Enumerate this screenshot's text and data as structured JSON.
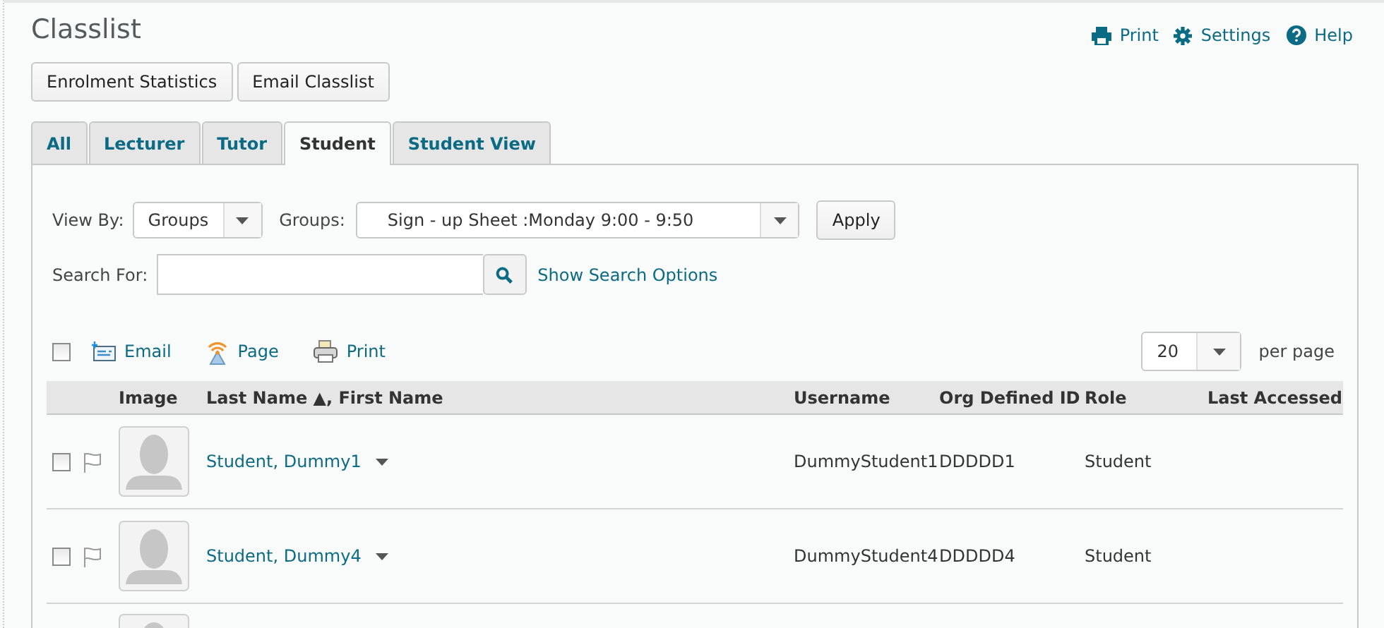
{
  "page": {
    "title": "Classlist"
  },
  "top_links": [
    {
      "kind": "print",
      "label": "Print"
    },
    {
      "kind": "settings",
      "label": "Settings"
    },
    {
      "kind": "help",
      "label": "Help"
    }
  ],
  "buttons": [
    "Enrolment Statistics",
    "Email Classlist"
  ],
  "tabs": [
    {
      "label": "All",
      "selected": false
    },
    {
      "label": "Lecturer",
      "selected": false
    },
    {
      "label": "Tutor",
      "selected": false
    },
    {
      "label": "Student",
      "selected": true
    },
    {
      "label": "Student View",
      "selected": false
    }
  ],
  "filters": {
    "view_by_label": "View By:",
    "view_by_value": "Groups",
    "groups_label": "Groups:",
    "groups_value": "Sign - up Sheet :Monday 9:00 - 9:50",
    "apply": "Apply"
  },
  "search": {
    "label": "Search For:",
    "options_link": "Show Search Options"
  },
  "toolbar": {
    "select_all_checked": false,
    "actions": [
      {
        "kind": "email",
        "label": "Email"
      },
      {
        "kind": "page",
        "label": "Page"
      },
      {
        "kind": "print",
        "label": "Print"
      }
    ],
    "page_size": "20",
    "per_page": "per page"
  },
  "table": {
    "columns": [
      "Image",
      "Last Name ▲, First Name",
      "Username",
      "Org Defined ID",
      "Role",
      "Last Accessed"
    ],
    "rows": [
      {
        "kind": "full",
        "checked": false,
        "name": "Student, Dummy1",
        "username": "DummyStudent1",
        "org_id": "DDDDD1",
        "role": "Student"
      },
      {
        "kind": "full",
        "checked": false,
        "name": "Student, Dummy4",
        "username": "DummyStudent4",
        "org_id": "DDDDD4",
        "role": "Student"
      },
      {
        "kind": "partial"
      }
    ]
  }
}
